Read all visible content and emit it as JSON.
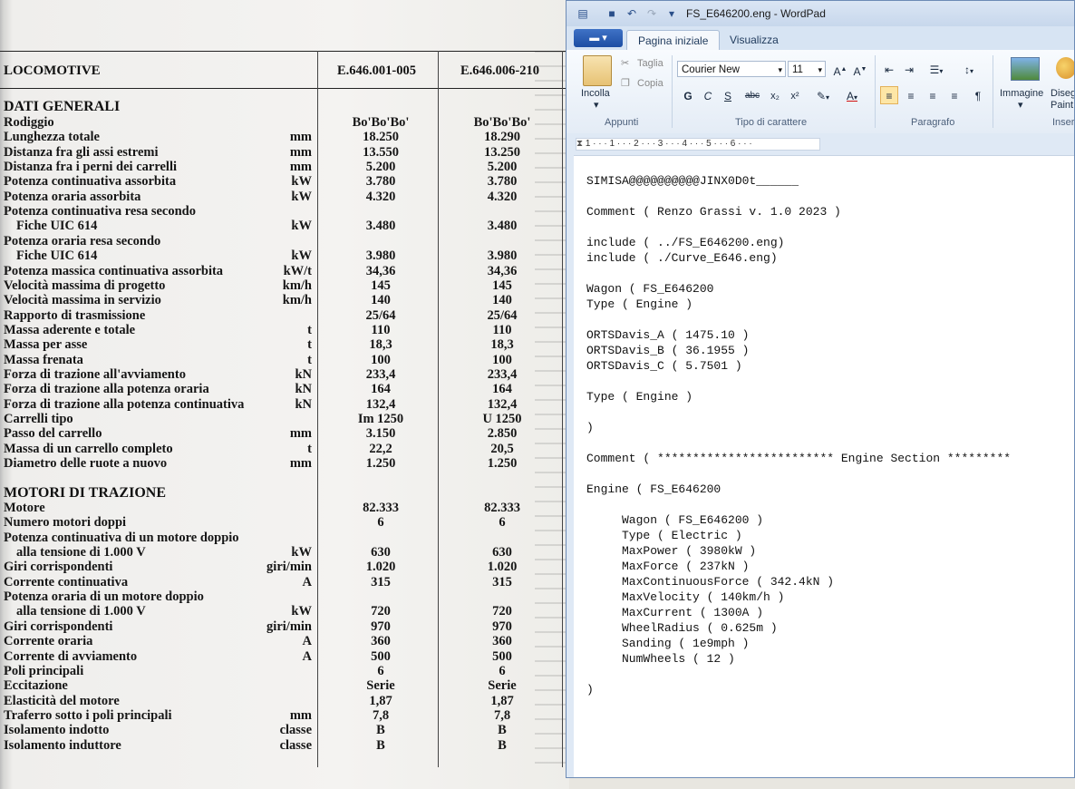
{
  "scan": {
    "header": {
      "col0": "LOCOMOTIVE",
      "col1": "E.646.001-005",
      "col2": "E.646.006-210"
    },
    "section1": "DATI GENERALI",
    "rows1": [
      {
        "label": "Rodiggio",
        "unit": "",
        "v1": "Bo'Bo'Bo'",
        "v2": "Bo'Bo'Bo'"
      },
      {
        "label": "Lunghezza totale",
        "unit": "mm",
        "v1": "18.250",
        "v2": "18.290"
      },
      {
        "label": "Distanza fra gli assi estremi",
        "unit": "mm",
        "v1": "13.550",
        "v2": "13.250"
      },
      {
        "label": "Distanza fra i perni dei carrelli",
        "unit": "mm",
        "v1": "5.200",
        "v2": "5.200"
      },
      {
        "label": "Potenza continuativa assorbita",
        "unit": "kW",
        "v1": "3.780",
        "v2": "3.780"
      },
      {
        "label": "Potenza oraria assorbita",
        "unit": "kW",
        "v1": "4.320",
        "v2": "4.320"
      },
      {
        "label": "Potenza continuativa resa secondo",
        "unit": "",
        "v1": "",
        "v2": ""
      },
      {
        "label": "Fiche UIC 614",
        "indent": true,
        "unit": "kW",
        "v1": "3.480",
        "v2": "3.480"
      },
      {
        "label": "Potenza oraria resa secondo",
        "unit": "",
        "v1": "",
        "v2": ""
      },
      {
        "label": "Fiche UIC 614",
        "indent": true,
        "unit": "kW",
        "v1": "3.980",
        "v2": "3.980"
      },
      {
        "label": "Potenza massica continuativa assorbita",
        "unit": "kW/t",
        "v1": "34,36",
        "v2": "34,36"
      },
      {
        "label": "Velocità massima di progetto",
        "unit": "km/h",
        "v1": "145",
        "v2": "145"
      },
      {
        "label": "Velocità massima in servizio",
        "unit": "km/h",
        "v1": "140",
        "v2": "140"
      },
      {
        "label": "Rapporto di trasmissione",
        "unit": "",
        "v1": "25/64",
        "v2": "25/64"
      },
      {
        "label": "Massa aderente e totale",
        "unit": "t",
        "v1": "110",
        "v2": "110"
      },
      {
        "label": "Massa per asse",
        "unit": "t",
        "v1": "18,3",
        "v2": "18,3"
      },
      {
        "label": "Massa frenata",
        "unit": "t",
        "v1": "100",
        "v2": "100"
      },
      {
        "label": "Forza di trazione all'avviamento",
        "unit": "kN",
        "v1": "233,4",
        "v2": "233,4"
      },
      {
        "label": "Forza di trazione alla potenza oraria",
        "unit": "kN",
        "v1": "164",
        "v2": "164"
      },
      {
        "label": "Forza di trazione alla potenza continuativa",
        "unit": "kN",
        "v1": "132,4",
        "v2": "132,4"
      },
      {
        "label": "Carrelli tipo",
        "unit": "",
        "v1": "Im 1250",
        "v2": "U 1250"
      },
      {
        "label": "Passo del carrello",
        "unit": "mm",
        "v1": "3.150",
        "v2": "2.850"
      },
      {
        "label": "Massa di un carrello completo",
        "unit": "t",
        "v1": "22,2",
        "v2": "20,5"
      },
      {
        "label": "Diametro delle ruote a nuovo",
        "unit": "mm",
        "v1": "1.250",
        "v2": "1.250"
      }
    ],
    "section2": "MOTORI DI TRAZIONE",
    "rows2": [
      {
        "label": "Motore",
        "unit": "",
        "v1": "82.333",
        "v2": "82.333"
      },
      {
        "label": "Numero motori doppi",
        "unit": "",
        "v1": "6",
        "v2": "6"
      },
      {
        "label": "Potenza continuativa di un motore doppio",
        "unit": "",
        "v1": "",
        "v2": ""
      },
      {
        "label": "alla tensione di 1.000 V",
        "indent": true,
        "unit": "kW",
        "v1": "630",
        "v2": "630"
      },
      {
        "label": "Giri corrispondenti",
        "unit": "giri/min",
        "v1": "1.020",
        "v2": "1.020"
      },
      {
        "label": "Corrente continuativa",
        "unit": "A",
        "v1": "315",
        "v2": "315"
      },
      {
        "label": "Potenza oraria di un motore doppio",
        "unit": "",
        "v1": "",
        "v2": ""
      },
      {
        "label": "alla tensione di 1.000 V",
        "indent": true,
        "unit": "kW",
        "v1": "720",
        "v2": "720"
      },
      {
        "label": "Giri corrispondenti",
        "unit": "giri/min",
        "v1": "970",
        "v2": "970"
      },
      {
        "label": "Corrente oraria",
        "unit": "A",
        "v1": "360",
        "v2": "360"
      },
      {
        "label": "Corrente di avviamento",
        "unit": "A",
        "v1": "500",
        "v2": "500"
      },
      {
        "label": "Poli principali",
        "unit": "",
        "v1": "6",
        "v2": "6"
      },
      {
        "label": "Eccitazione",
        "unit": "",
        "v1": "Serie",
        "v2": "Serie"
      },
      {
        "label": "Elasticità del motore",
        "unit": "",
        "v1": "1,87",
        "v2": "1,87"
      },
      {
        "label": "Traferro sotto i poli principali",
        "unit": "mm",
        "v1": "7,8",
        "v2": "7,8"
      },
      {
        "label": "Isolamento indotto",
        "unit": "classe",
        "v1": "B",
        "v2": "B"
      },
      {
        "label": "Isolamento induttore",
        "unit": "classe",
        "v1": "B",
        "v2": "B"
      }
    ]
  },
  "wordpad": {
    "title": "FS_E646200.eng - WordPad",
    "tabs": {
      "home": "Pagina iniziale",
      "view": "Visualizza"
    },
    "clipboard": {
      "paste": "Incolla",
      "cut": "Taglia",
      "copy": "Copia",
      "group": "Appunti"
    },
    "font": {
      "family": "Courier New",
      "size": "11",
      "group": "Tipo di carattere",
      "bold": "G",
      "italic": "C",
      "underline": "S",
      "strike": "abc",
      "sub": "x₂",
      "sup": "x²"
    },
    "paragraph": {
      "group": "Paragrafo"
    },
    "insert": {
      "picture": "Immagine",
      "paint": "Disegno di Paint",
      "group": "Inserisci"
    },
    "ruler": "1 · · · 1 · · · 2 · · · 3 · · · 4 · · · 5 · · · 6 · · ·",
    "document": [
      "SIMISA@@@@@@@@@@JINX0D0t______",
      "",
      "Comment ( Renzo Grassi v. 1.0 2023 )",
      "",
      "include ( ../FS_E646200.eng)",
      "include ( ./Curve_E646.eng)",
      "",
      "Wagon ( FS_E646200",
      "Type ( Engine )",
      "",
      "ORTSDavis_A ( 1475.10 )",
      "ORTSDavis_B ( 36.1955 )",
      "ORTSDavis_C ( 5.7501 )",
      "",
      "Type ( Engine )",
      "",
      ")",
      "",
      "Comment ( ************************* Engine Section *********",
      "",
      "Engine ( FS_E646200",
      "",
      "     Wagon ( FS_E646200 )",
      "     Type ( Electric )",
      "     MaxPower ( 3980kW )",
      "     MaxForce ( 237kN )",
      "     MaxContinuousForce ( 342.4kN )",
      "     MaxVelocity ( 140km/h )",
      "     MaxCurrent ( 1300A )",
      "     WheelRadius ( 0.625m )",
      "     Sanding ( 1e9mph )",
      "     NumWheels ( 12 )",
      "",
      ")"
    ]
  }
}
